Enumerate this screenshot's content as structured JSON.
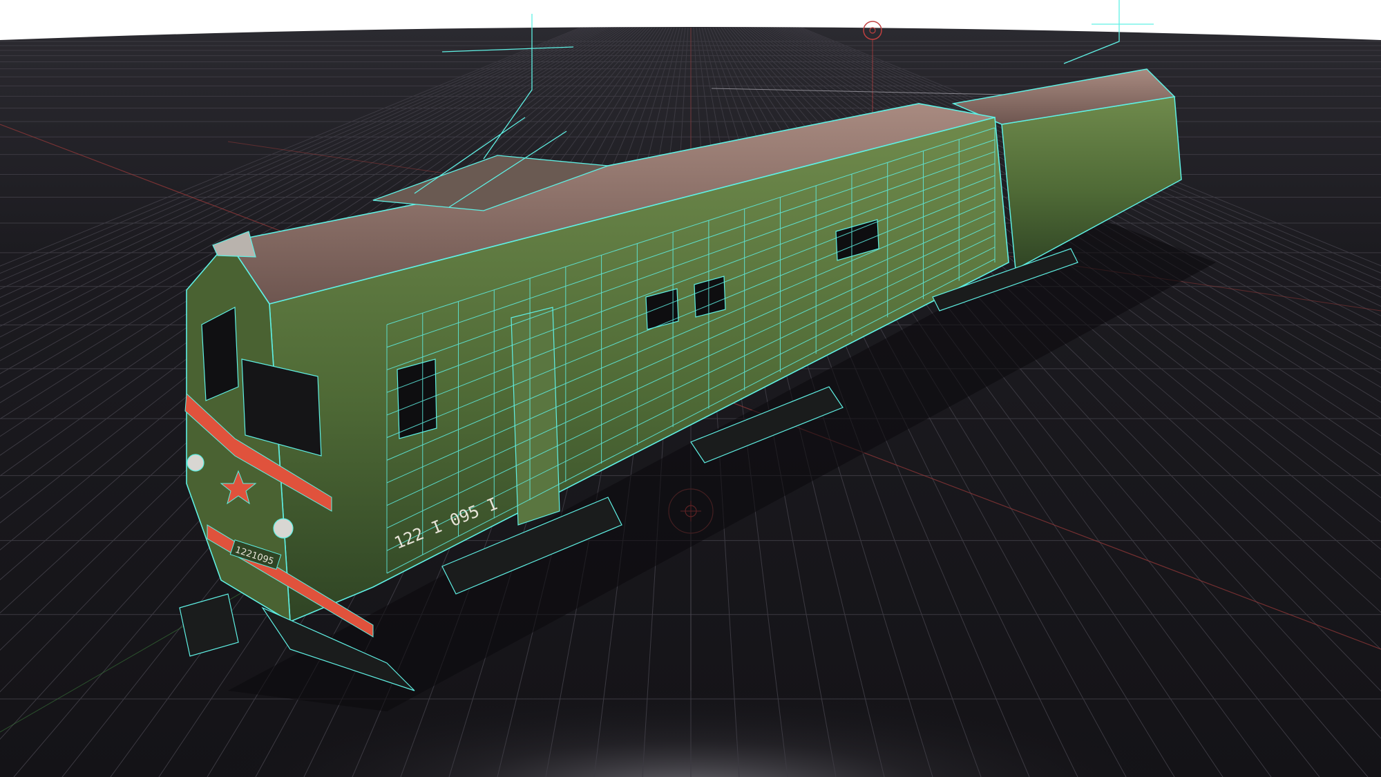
{
  "viewport": {
    "background_sky": "#ffffff",
    "ground_color": "#17151a",
    "grid_color": "#3c3a42",
    "axis_x_color": "#9c3a3a",
    "axis_y_color": "#3a7a3a",
    "wire_color": "#5ff0e4"
  },
  "model": {
    "body_color": "#4f6a36",
    "body_dark": "#2f4424",
    "roof_color": "#8a6c62",
    "stripe_color": "#e0523c",
    "number_plate": "1221095",
    "side_number": "122 I 095 I"
  },
  "gizmo": {
    "pivot_icon": "pivot-icon",
    "light_icon": "light-icon"
  }
}
